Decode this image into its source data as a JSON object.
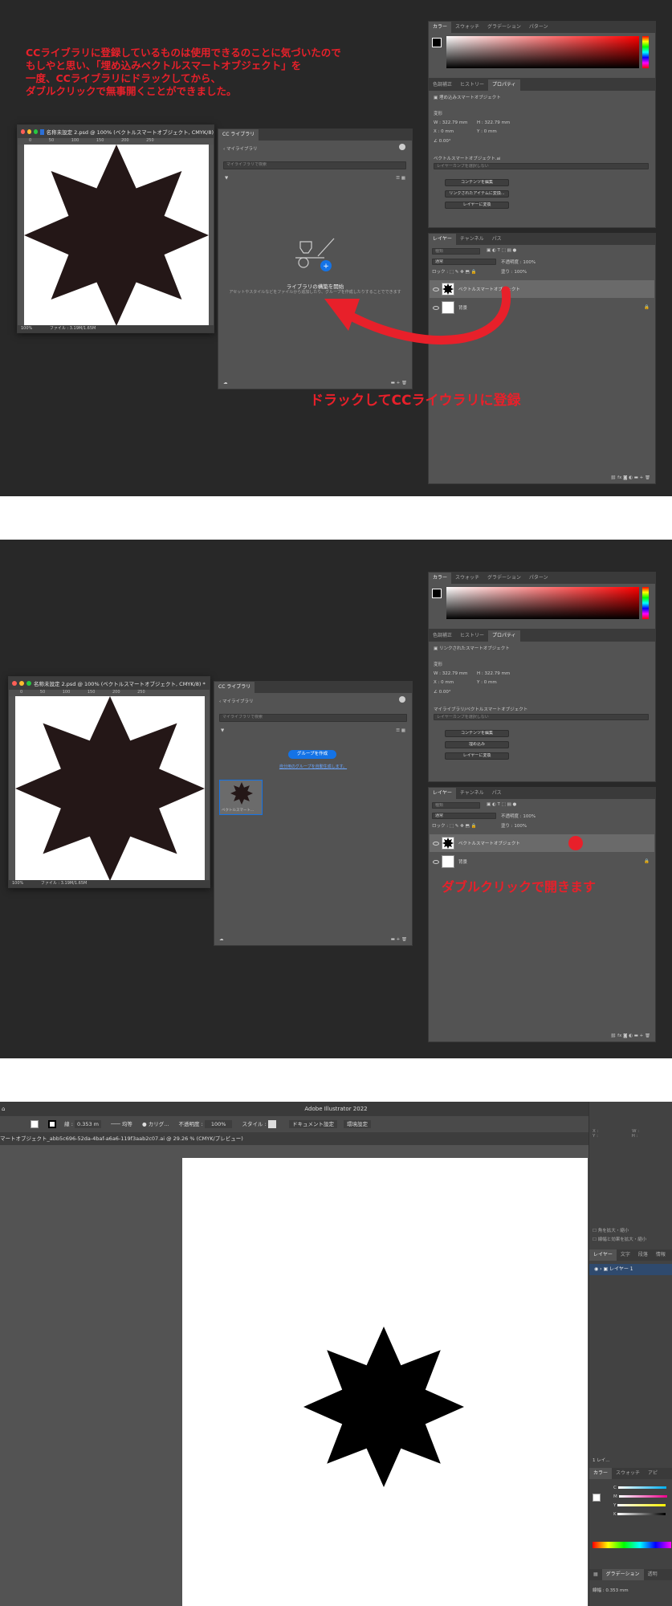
{
  "section1": {
    "annotation_lines": [
      "CCライブラリに登録しているものは使用できるのことに気づいたので",
      "もしやと思い、「埋め込みベクトルスマートオブジェクト」を",
      "一度、CCライブラリにドラックしてから、",
      "ダブルクリックで無事開くことができました。"
    ],
    "drag_annotation": "ドラックしてCCライウラリに登録",
    "doc": {
      "title": "名称未設定 2.psd @ 100% (ベクトルスマートオブジェクト, CMYK/8)",
      "ruler": "0 50 100 150 200 250",
      "zoom": "100%",
      "file": "ファイル : 3.19M/1.65M"
    },
    "cc": {
      "tab": "CC ライブラリ",
      "back": "マイライブラリ",
      "search": "マイライブラリで検索",
      "empty_title": "ライブラリの構築を開始",
      "empty_desc": "アセットやスタイルなどをファイルから追加したり、グループを作成したりすることでできます"
    },
    "color_tabs": [
      "カラー",
      "スウォッチ",
      "グラデーション",
      "パターン"
    ],
    "prop_tabs": [
      "色調補正",
      "ヒストリー",
      "プロパティ"
    ],
    "prop_kind": "埋め込みスマートオブジェクト",
    "transform": "変形",
    "w": "W : 322.79 mm",
    "h": "H : 322.79 mm",
    "x": "X : 0 mm",
    "y": "Y : 0 mm",
    "angle": "0.00°",
    "source_label": "ベクトルスマートオブジェクト.ai",
    "select_layer_comp": "レイヤーカンプを選択しない",
    "buttons": [
      "コンテンツを編集",
      "リンクされたアイテムに変換...",
      "レイヤーに変換"
    ],
    "layer_tabs": [
      "レイヤー",
      "チャンネル",
      "パス"
    ],
    "kind": "種類",
    "blend": "通常",
    "opacity": "不透明度 : 100%",
    "lock": "ロック :",
    "fill": "塗り : 100%",
    "layers": [
      "ベクトルスマートオブジェクト",
      "背景"
    ]
  },
  "section2": {
    "doc": {
      "title": "名称未設定 2.psd @ 100% (ベクトルスマートオブジェクト, CMYK/8) *",
      "ruler": "0 50 100 150 200 250",
      "zoom": "100%",
      "file": "ファイル : 3.19M/1.65M"
    },
    "cc": {
      "tab": "CC ライブラリ",
      "back": "マイライブラリ",
      "search": "マイライブラリで検索",
      "create_group": "グループを作成",
      "auto_group": "自分用のグループを自動生成します。",
      "asset_label": "ベクトルスマート..."
    },
    "prop_kind": "リンクされたスマートオブジェクト",
    "source_label": "マイライブラリ/ベクトルスマートオブジェクト",
    "buttons": [
      "コンテンツを編集",
      "埋め込み",
      "レイヤーに変換"
    ],
    "dblclick_annotation": "ダブルクリックで開きます"
  },
  "section3": {
    "app_title": "Adobe Illustrator 2022",
    "stroke_label": "線 :",
    "stroke_value": "0.353 m",
    "stroke_style": "均等",
    "brush": "カリグ...",
    "opacity_label": "不透明度 :",
    "opacity": "100%",
    "style_label": "スタイル :",
    "doc_settings": "ドキュメント設定",
    "prefs": "環境設定",
    "doc_tab": "マートオブジェクト_abb5c696-52da-4baf-a6a6-119f3aab2c07.ai @ 29.26 % (CMYK/プレビュー)",
    "right_xy": [
      "X :",
      "Y :",
      "W :",
      "H :"
    ],
    "checks": [
      "角を拡大・縮小",
      "線幅と効果を拡大・縮小"
    ],
    "layer_tabs": [
      "レイヤー",
      "文字",
      "段落",
      "情報"
    ],
    "layer_name": "レイヤー 1",
    "layer_count": "1 レイ...",
    "color_tabs": [
      "カラー",
      "スウォッチ",
      "アピ"
    ],
    "cmyk": [
      "C",
      "M",
      "Y",
      "K"
    ],
    "grad_tabs": [
      "グラデーション",
      "透明"
    ],
    "stroke_bottom_label": "線幅 :",
    "stroke_bottom": "0.353 mm"
  },
  "colors": {
    "accent_red": "#e8202a",
    "panel_bg": "#535353",
    "dark_bg": "#282828",
    "blue": "#1473e6"
  }
}
